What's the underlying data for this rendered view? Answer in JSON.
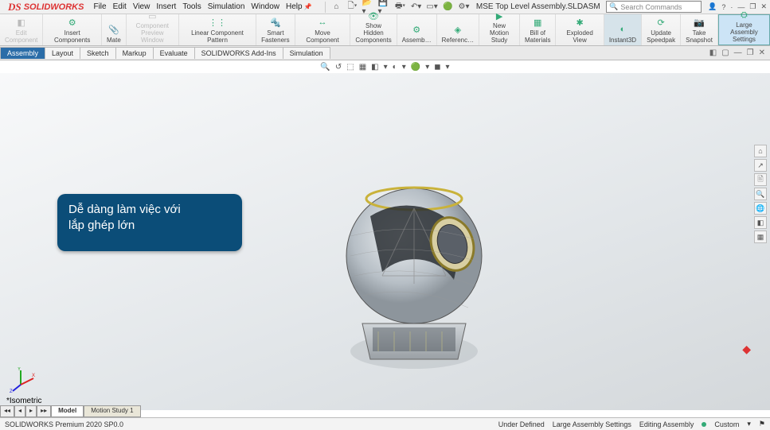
{
  "app": {
    "logo_text": "SOLIDWORKS",
    "doc_title": "MSE Top Level Assembly.SLDASM"
  },
  "menu": [
    "File",
    "Edit",
    "View",
    "Insert",
    "Tools",
    "Simulation",
    "Window",
    "Help"
  ],
  "search": {
    "placeholder": "Search Commands"
  },
  "title_right": {
    "help": "?",
    "min": "—",
    "restore": "❐",
    "close": "✕"
  },
  "ribbon": [
    {
      "id": "edit-component",
      "label": "Edit\nComponent",
      "disabled": true,
      "icon": "◧"
    },
    {
      "id": "insert-components",
      "label": "Insert Components",
      "icon": "⚙"
    },
    {
      "id": "mate",
      "label": "Mate",
      "icon": "📎"
    },
    {
      "id": "component-preview",
      "label": "Component\nPreview Window",
      "disabled": true,
      "icon": "▭"
    },
    {
      "id": "linear-pattern",
      "label": "Linear Component Pattern",
      "icon": "⋮⋮"
    },
    {
      "id": "smart-fasteners",
      "label": "Smart\nFasteners",
      "icon": "🔩"
    },
    {
      "id": "move-component",
      "label": "Move Component",
      "icon": "↔"
    },
    {
      "id": "show-hidden",
      "label": "Show Hidden\nComponents",
      "icon": "👁"
    },
    {
      "id": "assembly-tools",
      "label": "Assemb…",
      "icon": "⚙"
    },
    {
      "id": "reference",
      "label": "Referenc…",
      "icon": "◈"
    },
    {
      "id": "new-motion",
      "label": "New Motion\nStudy",
      "icon": "▶"
    },
    {
      "id": "bom",
      "label": "Bill of\nMaterials",
      "icon": "▦"
    },
    {
      "id": "exploded",
      "label": "Exploded View",
      "icon": "✱"
    },
    {
      "id": "instant3d",
      "label": "Instant3D",
      "icon": "◐",
      "pressed": true
    },
    {
      "id": "update-speedpak",
      "label": "Update\nSpeedpak",
      "icon": "⟳"
    },
    {
      "id": "take-snapshot",
      "label": "Take\nSnapshot",
      "icon": "📷"
    },
    {
      "id": "large-assembly",
      "label": "Large Assembly\nSettings",
      "icon": "⛭",
      "highlight": true
    }
  ],
  "cmd_tabs": [
    "Assembly",
    "Layout",
    "Sketch",
    "Markup",
    "Evaluate",
    "SOLIDWORKS Add-Ins",
    "Simulation"
  ],
  "cmd_tab_active": 0,
  "headsup_icons": [
    "🔍",
    "↺",
    "⬚",
    "▦",
    "◧",
    "▾",
    "◐",
    "▾",
    "🟢",
    "▾",
    "◼",
    "▾"
  ],
  "annotation": {
    "line1": "Dễ dàng làm việc với",
    "line2": "lắp ghép lớn"
  },
  "view_label": "*Isometric",
  "right_tools": [
    "⌂",
    "↗",
    "🖹",
    "🔍",
    "🌐",
    "◧",
    "▦"
  ],
  "bottom_tabs": {
    "nav_back": "◂◂",
    "nav_prev": "◂",
    "nav_next": "▸",
    "nav_end": "▸▸",
    "active": "Model",
    "others": [
      "Motion Study 1"
    ]
  },
  "status": {
    "left": "SOLIDWORKS Premium 2020 SP0.0",
    "right": [
      "Under Defined",
      "Large Assembly Settings",
      "Editing Assembly",
      "Custom",
      "—"
    ]
  }
}
